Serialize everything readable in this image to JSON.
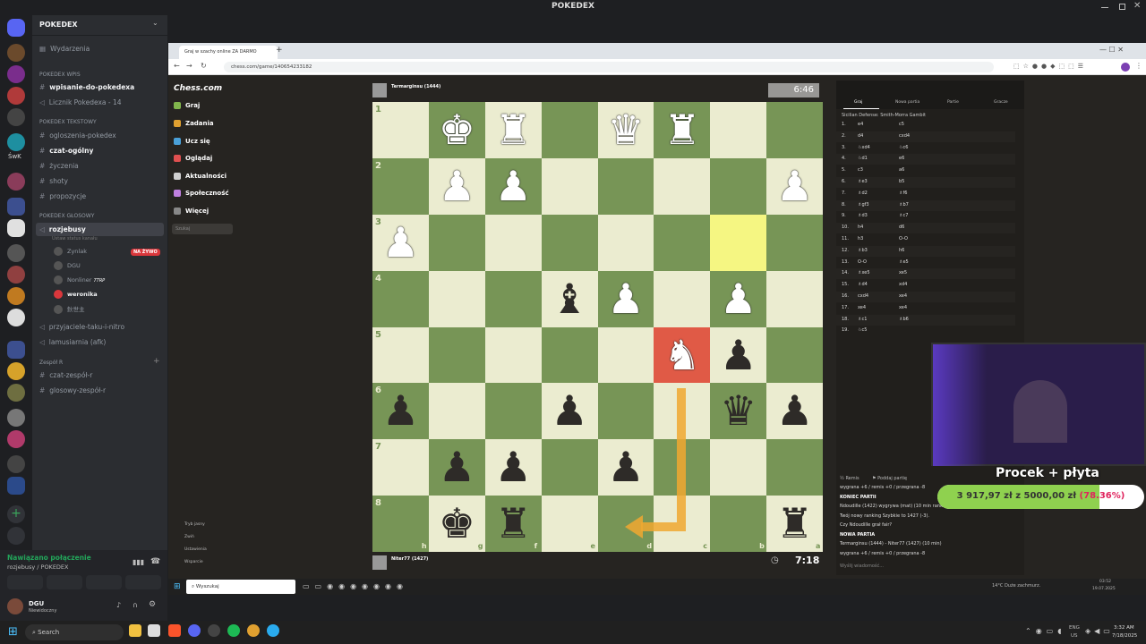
{
  "app": {
    "title": "POKEDEX"
  },
  "discord": {
    "server_name": "POKEDEX",
    "events": "Wydarzenia",
    "cat_wpis": "POKEDEX Wpis",
    "ch_wpisanie": "wpisanie-do-pokedexa",
    "ch_licznik": "Licznik Pokedexa - 14",
    "cat_tekst": "POKEDEX Tekstowy",
    "ch_ogloszenia": "ogloszenia-pokedex",
    "ch_czat": "czat-ogólny",
    "ch_zyczenia": "życzenia",
    "ch_shoty": "shoty",
    "ch_propozycje": "propozycje",
    "cat_glos": "POKEDEX GŁOSOWY",
    "ch_rozjebusy": "rozjebusy",
    "status_hint": "Ustaw status kanału",
    "voice_users": [
      "Zynlak",
      "DGU",
      "Nonliner",
      "weronika",
      "鈥世主"
    ],
    "live_badge": "NA ŻYWO",
    "nonliner_tag": "7TRP",
    "ch_przyjaciele": "przyjaciele-taku-i-nitro",
    "ch_lamusiarnia": "lamusiarnia (afk)",
    "cat_zespol": "Zespół R",
    "ch_czat_zespol": "czat-zespół-r",
    "ch_glos_zespol": "glosowy-zespół-r",
    "server_badge_swk": "ŚwK",
    "conn_status": "Nawiązano połączenie",
    "conn_sub": "rozjebusy / POKEDEX",
    "user_name": "DGU",
    "user_status": "Niewidoczny"
  },
  "browser": {
    "tab_title": "Graj w szachy online ZA DARMO",
    "url": "chess.com/game/140654233182"
  },
  "chess": {
    "logo": "Chess.com",
    "nav": [
      "Graj",
      "Zadania",
      "Ucz się",
      "Oglądaj",
      "Aktualności",
      "Społeczność",
      "Więcej"
    ],
    "search_placeholder": "Szukaj",
    "bottom_nav": [
      "Tryb jasny",
      "Zwiń",
      "Ustawienia",
      "Wsparcie"
    ],
    "opponent": "Termarginsu (1444)",
    "opponent_time": "6:46",
    "player": "Niter77 (1427)",
    "player_time": "7:18",
    "ranks": [
      "1",
      "2",
      "3",
      "4",
      "5",
      "6",
      "7",
      "8"
    ],
    "files": [
      "h",
      "g",
      "f",
      "e",
      "d",
      "c",
      "b",
      "a"
    ],
    "tabs": [
      "Graj",
      "Nowa partia",
      "Partie",
      "Gracze"
    ],
    "opening": "Sicilian Defense: Smith-Morra Gambit",
    "moves": [
      [
        "1.",
        "e4",
        "c5"
      ],
      [
        "2.",
        "d4",
        "cxd4"
      ],
      [
        "3.",
        "♘xd4",
        "♘c6"
      ],
      [
        "4.",
        "♘d1",
        "e6"
      ],
      [
        "5.",
        "c3",
        "a6"
      ],
      [
        "6.",
        "♗e3",
        "b5"
      ],
      [
        "7.",
        "♗d2",
        "♗f6"
      ],
      [
        "8.",
        "♗gf3",
        "♗b7"
      ],
      [
        "9.",
        "♗d3",
        "♗c7"
      ],
      [
        "10.",
        "h4",
        "d6"
      ],
      [
        "11.",
        "h3",
        "O-O"
      ],
      [
        "12.",
        "♗b3",
        "h6"
      ],
      [
        "13.",
        "O-O",
        "♗e5"
      ],
      [
        "14.",
        "♗xe5",
        "xe5"
      ],
      [
        "15.",
        "♗d4",
        "xd4"
      ],
      [
        "16.",
        "cxd4",
        "xe4"
      ],
      [
        "17.",
        "xe4",
        "xe4"
      ],
      [
        "18.",
        "♗c1",
        "♗b6"
      ],
      [
        "19.",
        "♘c5",
        ""
      ]
    ],
    "controls": [
      "Remis",
      "Poddaj partię"
    ],
    "chat_lines": [
      "wygrana +6 / remis +0 / przegrana -8",
      "KONIEC PARTII",
      "Ndoudille (1422) wygrywa (mat) (10 min rank",
      "Twój nowy ranking Szybkie to 1427 (-3).",
      "Czy Ndoudille grał fair?",
      "NOWA PARTIA",
      "Termarginsu (1444) - Niter77 (1427) (10 min)",
      "wygrana +6 / remis +0 / przegrana -8"
    ],
    "chat_placeholder": "Wyślij wiadomość..."
  },
  "overlay": {
    "title": "Procek + płyta",
    "amount": "3 917,97 zł",
    "of": "z",
    "goal": "5000,00 zł",
    "percent": "(78.36%)",
    "progress": 0.7836
  },
  "inner_taskbar": {
    "search": "Wyszukaj",
    "weather": "14°C  Duże zachmurz.",
    "time": "03:52",
    "date": "19.07.2025"
  },
  "taskbar": {
    "search": "Search",
    "lang": "ENG",
    "region": "US",
    "time": "3:32 AM",
    "date": "7/18/2025"
  }
}
